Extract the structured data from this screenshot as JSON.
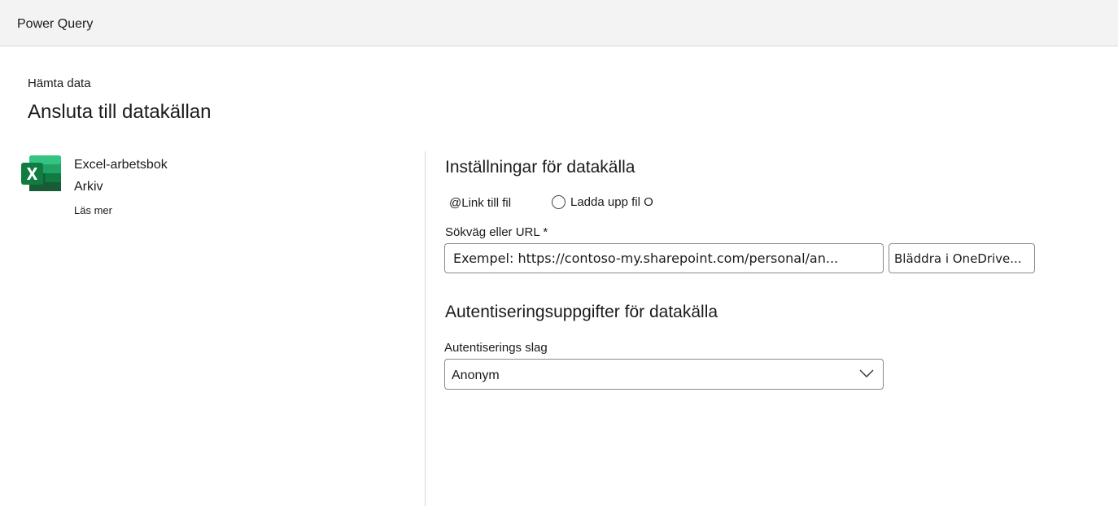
{
  "app": {
    "title": "Power Query"
  },
  "header": {
    "breadcrumb": "Hämta data",
    "title": "Ansluta till datakällan"
  },
  "connector": {
    "icon": "excel-icon",
    "name": "Excel-arbetsbok",
    "category": "Arkiv",
    "learn_more": "Läs mer"
  },
  "settings": {
    "title": "Inställningar för datakälla",
    "radio_link_label": "@Link till fil",
    "radio_upload_label": "Ladda upp fil O",
    "url_label": "Sökväg eller URL *",
    "url_placeholder": "Exempel: https://contoso-my.sharepoint.com/personal/an...",
    "url_value": "",
    "browse_label": "Bläddra i OneDrive..."
  },
  "auth": {
    "title": "Autentiseringsuppgifter för datakälla",
    "kind_label": "Autentiserings slag",
    "kind_value": "Anonym"
  },
  "colors": {
    "excel_green": "#1d6f42",
    "topbar": "#f3f3f3",
    "border": "#8a8a8a"
  }
}
